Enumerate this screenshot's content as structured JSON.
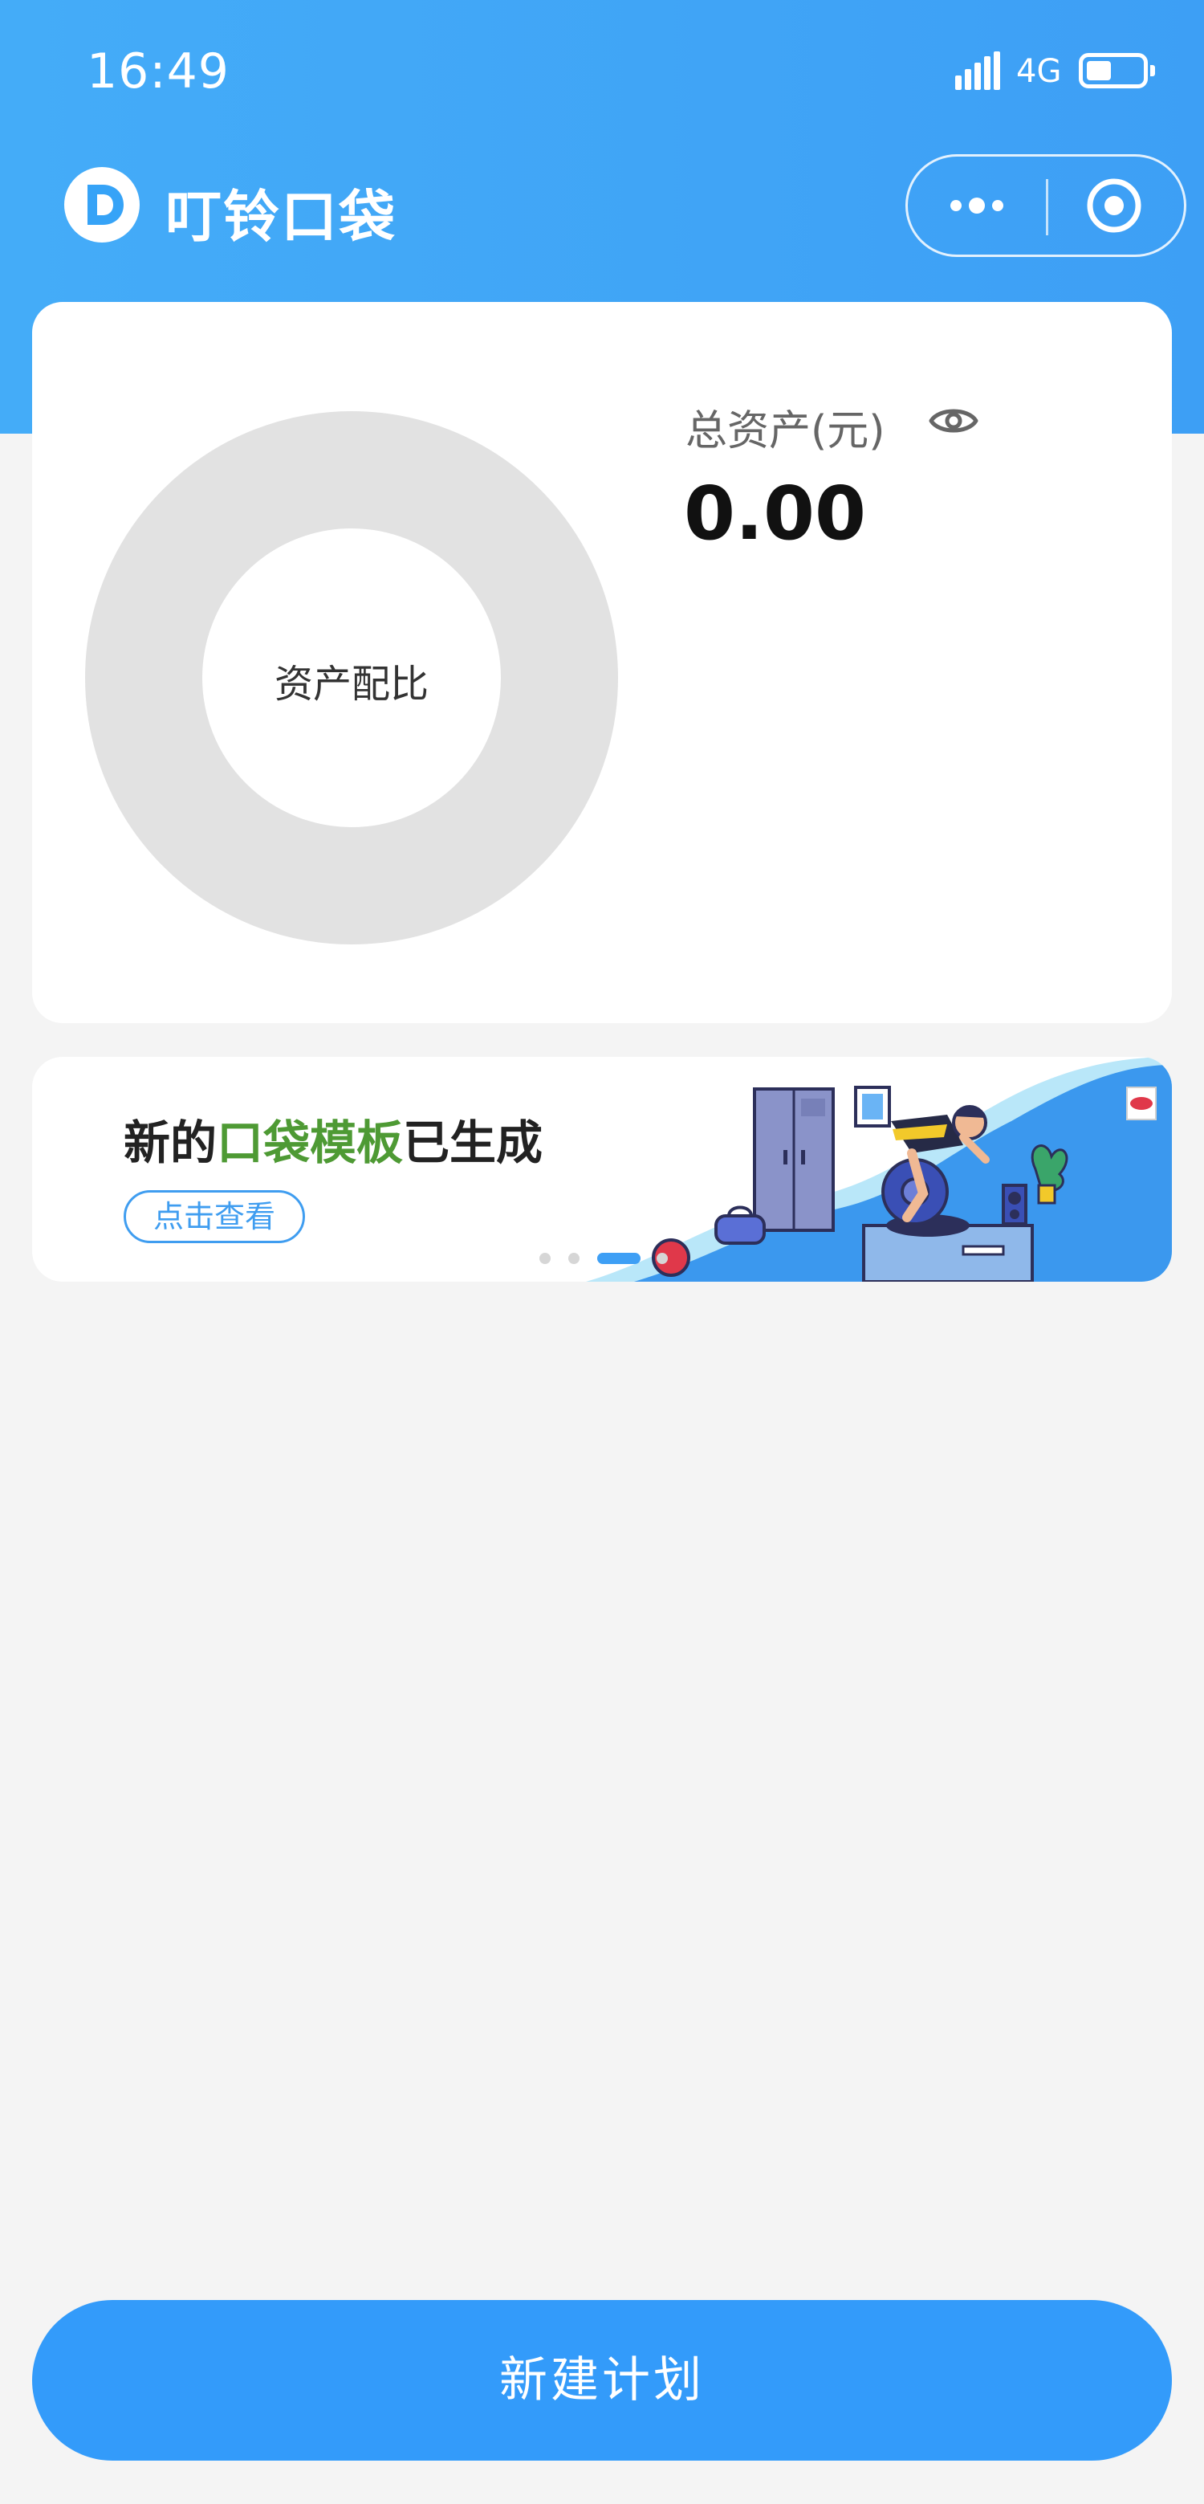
{
  "status_bar": {
    "time": "16:49",
    "network": "4G",
    "battery_level": 0.45
  },
  "nav": {
    "title": "叮铃口袋",
    "logo_icon": "app-logo-d-icon",
    "more_icon": "more-dots-icon",
    "close_icon": "target-circle-icon"
  },
  "asset_card": {
    "donut_label": "资产配比",
    "total_label": "总资产(元)",
    "total_value": "0.00",
    "visibility_icon": "eye-icon"
  },
  "banner": {
    "headline_prefix": "新的",
    "headline_highlight": "口袋模板",
    "headline_suffix": "已生成",
    "cta_label": "点击查看",
    "active_slide": 3,
    "slide_count": 4
  },
  "bottom": {
    "create_button_label": "新建计划"
  },
  "colors": {
    "header": "#44acf8",
    "accent": "#339bfa",
    "highlight": "#4e9a34",
    "donut_ring": "#e2e2e2"
  }
}
